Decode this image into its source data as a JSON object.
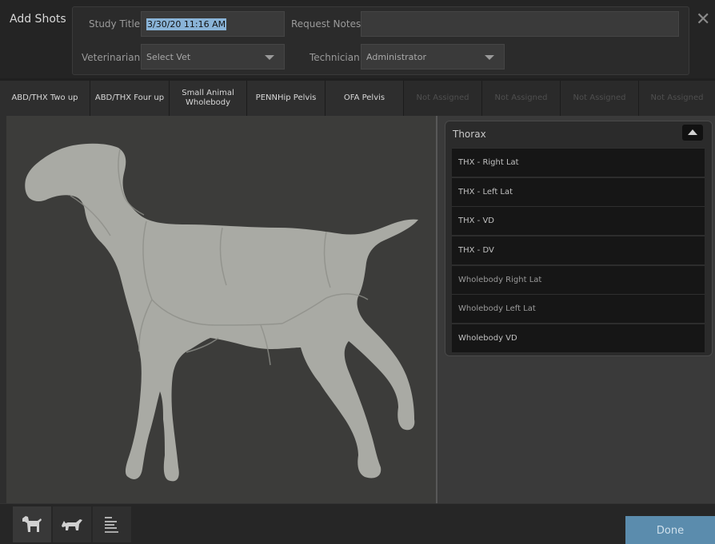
{
  "header": {
    "title": "Add Shots",
    "study_title_label": "Study Title",
    "study_title_value": "3/30/20 11:16 AM",
    "request_notes_label": "Request Notes",
    "request_notes_value": "",
    "veterinarian_label": "Veterinarian",
    "veterinarian_value": "Select Vet",
    "technician_label": "Technician",
    "technician_value": "Administrator"
  },
  "tabs": [
    {
      "label": "ABD/THX Two up"
    },
    {
      "label": "ABD/THX Four up"
    },
    {
      "label": "Small Animal Wholebody"
    },
    {
      "label": "PENNHip Pelvis"
    },
    {
      "label": "OFA Pelvis"
    },
    {
      "label": "Not Assigned"
    },
    {
      "label": "Not Assigned"
    },
    {
      "label": "Not Assigned"
    },
    {
      "label": "Not Assigned"
    }
  ],
  "group": {
    "title": "Thorax",
    "items": [
      {
        "label": "THX - Right Lat"
      },
      {
        "label": "THX - Left Lat"
      },
      {
        "label": "THX - VD"
      },
      {
        "label": "THX - DV"
      },
      {
        "label": "Wholebody Right Lat"
      },
      {
        "label": "Wholebody Left Lat"
      },
      {
        "label": "Wholebody VD"
      }
    ]
  },
  "footer": {
    "done_label": "Done"
  },
  "icons": {
    "close": "close-icon",
    "dog": "dog-icon",
    "cat": "cat-icon",
    "list": "list-icon"
  },
  "colors": {
    "accent": "#5b8cad",
    "selection": "#8ab4d8",
    "silhouette": "#a9aaa4"
  }
}
